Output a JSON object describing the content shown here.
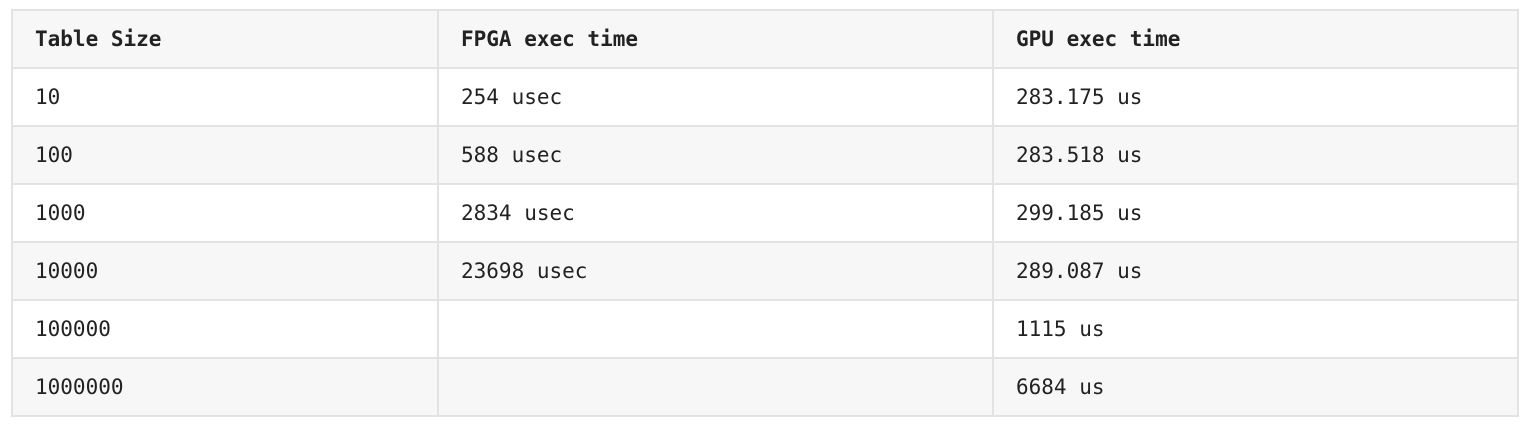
{
  "table": {
    "headers": [
      "Table Size",
      "FPGA exec time",
      "GPU exec time"
    ],
    "rows": [
      [
        "10",
        "254 usec",
        "283.175 us"
      ],
      [
        "100",
        "588 usec",
        "283.518 us"
      ],
      [
        "1000",
        "2834 usec",
        "299.185 us"
      ],
      [
        "10000",
        "23698 usec",
        "289.087 us"
      ],
      [
        "100000",
        "",
        "1115 us"
      ],
      [
        "1000000",
        "",
        "6684 us"
      ]
    ]
  }
}
